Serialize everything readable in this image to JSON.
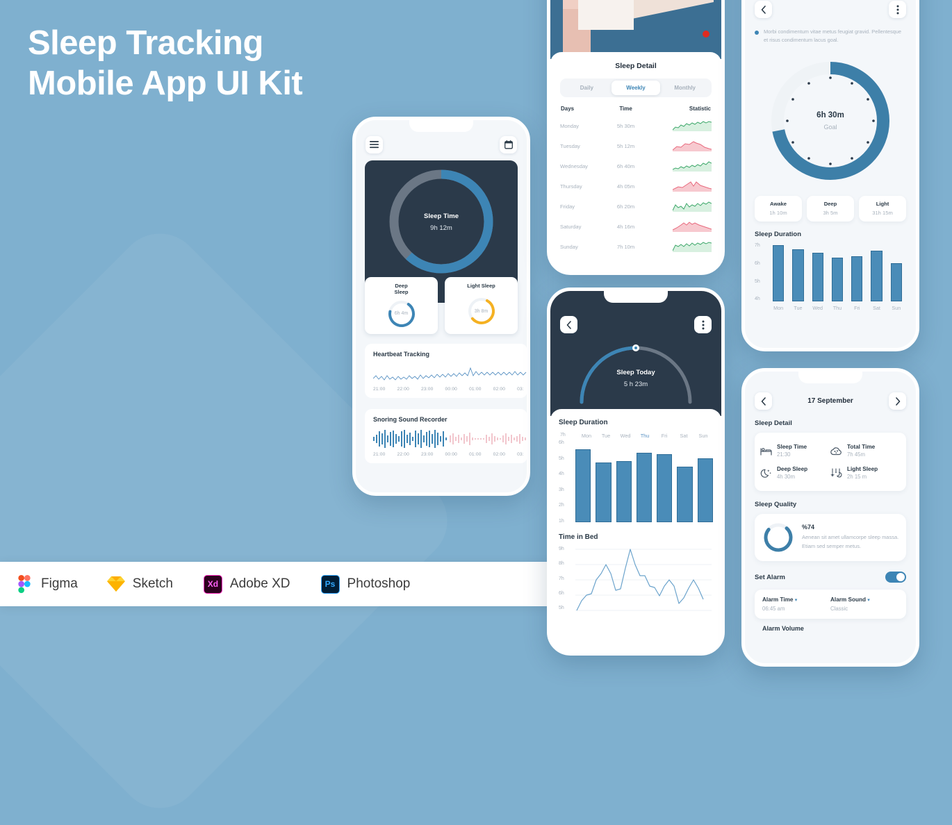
{
  "hero": {
    "line1": "Sleep Tracking",
    "line2": "Mobile App UI Kit"
  },
  "toolbar": {
    "tools": [
      {
        "name": "Figma",
        "icon": "figma-logo"
      },
      {
        "name": "Sketch",
        "icon": "sketch-logo"
      },
      {
        "name": "Adobe XD",
        "icon": "adobexd-logo",
        "mark": "Xd"
      },
      {
        "name": "Photoshop",
        "icon": "photoshop-logo",
        "mark": "Ps"
      }
    ]
  },
  "colors": {
    "background": "#7fb0cf",
    "accent_blue": "#3d85b5",
    "dark_panel": "#2b3a4a",
    "amber": "#f5b122",
    "muted_text": "#a8b2bd"
  },
  "phone1": {
    "menu_icon": "hamburger-icon",
    "calendar_icon": "calendar-icon",
    "dial": {
      "title": "Sleep Time",
      "value": "9h 12m",
      "percent": 62
    },
    "cards": [
      {
        "title": "Deep\nSleep",
        "value": "6h 4m",
        "color": "#3d85b5",
        "percent": 68
      },
      {
        "title": "Light Sleep",
        "value": "3h 8m",
        "color": "#f5b122",
        "percent": 55
      }
    ],
    "heartbeat": {
      "title": "Heartbeat Tracking",
      "ticks": [
        "21:00",
        "22:00",
        "23:00",
        "00:00",
        "01:00",
        "02:00",
        "03:"
      ]
    },
    "snoring": {
      "title": "Snoring Sound Recorder",
      "ticks": [
        "21:00",
        "22:00",
        "23:00",
        "00:00",
        "01:00",
        "02:00",
        "03:"
      ]
    }
  },
  "phone2": {
    "title": "Sleep Detail",
    "tabs": [
      {
        "label": "Daily",
        "active": false
      },
      {
        "label": "Weekly",
        "active": true
      },
      {
        "label": "Monthly",
        "active": false
      }
    ],
    "columns": [
      "Days",
      "Time",
      "Statistic"
    ],
    "rows": [
      {
        "day": "Monday",
        "time": "5h 30m",
        "trend": "up"
      },
      {
        "day": "Tuesday",
        "time": "5h 12m",
        "trend": "down"
      },
      {
        "day": "Wednesday",
        "time": "6h 40m",
        "trend": "up"
      },
      {
        "day": "Thursday",
        "time": "4h 05m",
        "trend": "down"
      },
      {
        "day": "Friday",
        "time": "6h 20m",
        "trend": "up"
      },
      {
        "day": "Saturday",
        "time": "4h 16m",
        "trend": "down"
      },
      {
        "day": "Sunday",
        "time": "7h 10m",
        "trend": "up"
      }
    ]
  },
  "phone3": {
    "back_icon": "chevron-left-icon",
    "more_icon": "kebab-menu-icon",
    "gauge": {
      "title": "Sleep Today",
      "value": "5 h 23m",
      "percent": 50
    },
    "duration_title": "Sleep Duration",
    "bed_title": "Time in Bed"
  },
  "phone4": {
    "back_icon": "chevron-left-icon",
    "more_icon": "kebab-menu-icon",
    "note": "Morbi condimentum vitae metus feugiat gravid. Pellentesque et risus condimentum lacus goal.",
    "goal": {
      "value": "6h 30m",
      "label": "Goal",
      "percent": 72
    },
    "stats": [
      {
        "key": "Awake",
        "value": "1h 10m"
      },
      {
        "key": "Deep",
        "value": "3h 5m"
      },
      {
        "key": "Light",
        "value": "31h 15m"
      }
    ],
    "duration_title": "Sleep Duration"
  },
  "phone5": {
    "prev_icon": "chevron-left-icon",
    "next_icon": "chevron-right-icon",
    "date": "17 September",
    "detail_title": "Sleep Detail",
    "details": [
      {
        "icon": "bed-icon",
        "key": "Sleep Time",
        "value": "21:30"
      },
      {
        "icon": "cloud-icon",
        "key": "Total Time",
        "value": "7h 45m"
      },
      {
        "icon": "moon-icon",
        "key": "Deep Sleep",
        "value": "4h 30m"
      },
      {
        "icon": "stars-icon",
        "key": "Light Sleep",
        "value": "2h 15 m"
      }
    ],
    "quality_title": "Sleep Quality",
    "quality": {
      "percent_label": "%74",
      "percent": 74,
      "text": "Aenean sit amet ullamcorpe sleep massa. Etiam sed semper metus."
    },
    "alarm_title": "Set Alarm",
    "alarm_on": true,
    "alarm_time_label": "Alarm Time",
    "alarm_time_value": "06:45 am",
    "alarm_sound_label": "Alarm Sound",
    "alarm_sound_value": "Classic",
    "alarm_volume_label": "Alarm Volume"
  },
  "chart_data": [
    {
      "id": "phone3-sleep-duration",
      "type": "bar",
      "title": "Sleep Duration",
      "categories": [
        "Mon",
        "Tue",
        "Wed",
        "Thu",
        "Fri",
        "Sat",
        "Sun"
      ],
      "values": [
        6.1,
        5.2,
        5.3,
        5.9,
        5.8,
        4.95,
        5.5
      ],
      "ylabel": "",
      "xlabel": "",
      "yticks": [
        "7h",
        "6h",
        "5h",
        "4h",
        "3h",
        "2h",
        "1h"
      ],
      "ylim": [
        1,
        7
      ],
      "highlight_category": "Thu",
      "grid": false,
      "color": "#4a8cb8"
    },
    {
      "id": "phone3-time-in-bed",
      "type": "line",
      "title": "Time in Bed",
      "yticks": [
        "9h",
        "8h",
        "7h",
        "6h",
        "5h"
      ],
      "ylim": [
        5,
        9
      ],
      "values": [
        5.0,
        5.6,
        6.0,
        6.1,
        7.0,
        7.4,
        8.2,
        7.4,
        6.3,
        6.4,
        7.6,
        9.0,
        8.2,
        7.5,
        7.5,
        6.6,
        6.5,
        5.9,
        6.4,
        7.0,
        6.6,
        5.2,
        5.6,
        6.3,
        7.0,
        6.4,
        5.6
      ],
      "grid": true,
      "color": "#6ba3cc"
    },
    {
      "id": "phone4-sleep-duration",
      "type": "bar",
      "title": "Sleep Duration",
      "categories": [
        "Mon",
        "Tue",
        "Wed",
        "Thu",
        "Fri",
        "Sat",
        "Sun"
      ],
      "values": [
        7.1,
        6.9,
        6.7,
        6.4,
        6.45,
        6.8,
        6.1
      ],
      "yticks": [
        "7h",
        "6h",
        "5h",
        "4h"
      ],
      "ylim": [
        4,
        7.3
      ],
      "grid": false,
      "color": "#4a8cb8"
    },
    {
      "id": "phone1-heartbeat",
      "type": "line",
      "title": "Heartbeat Tracking",
      "xticks": [
        "21:00",
        "22:00",
        "23:00",
        "00:00",
        "01:00",
        "02:00",
        "03:"
      ],
      "color": "#5b93c4"
    },
    {
      "id": "phone1-snoring",
      "type": "bar",
      "title": "Snoring Sound Recorder",
      "xticks": [
        "21:00",
        "22:00",
        "23:00",
        "00:00",
        "01:00",
        "02:00",
        "03:"
      ],
      "color": "#4a8cb8"
    },
    {
      "id": "phone2-statistics",
      "type": "area",
      "title": "Statistic",
      "series": [
        {
          "name": "Monday",
          "trend": "up",
          "color": "#3fa86b"
        },
        {
          "name": "Tuesday",
          "trend": "down",
          "color": "#e8697d"
        },
        {
          "name": "Wednesday",
          "trend": "up",
          "color": "#3fa86b"
        },
        {
          "name": "Thursday",
          "trend": "down",
          "color": "#e8697d"
        },
        {
          "name": "Friday",
          "trend": "up",
          "color": "#3fa86b"
        },
        {
          "name": "Saturday",
          "trend": "down",
          "color": "#e8697d"
        },
        {
          "name": "Sunday",
          "trend": "up",
          "color": "#3fa86b"
        }
      ]
    }
  ]
}
